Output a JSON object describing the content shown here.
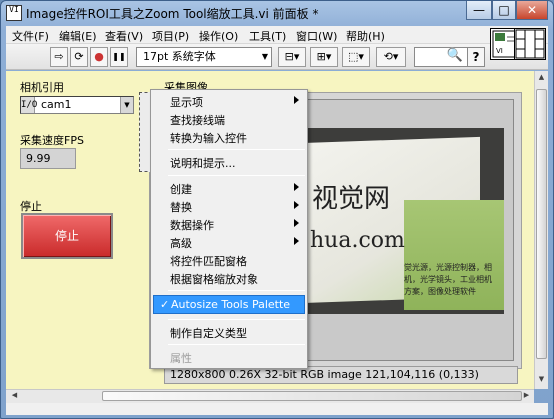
{
  "window": {
    "title": "Image控件ROI工具之Zoom Tool缩放工具.vi 前面板 *",
    "icon_text": "VI",
    "minimize_glyph": "—",
    "maximize_glyph": "□",
    "close_glyph": "✕"
  },
  "menubar": {
    "items": [
      {
        "label": "文件(F)"
      },
      {
        "label": "编辑(E)"
      },
      {
        "label": "查看(V)"
      },
      {
        "label": "项目(P)"
      },
      {
        "label": "操作(O)"
      },
      {
        "label": "工具(T)"
      },
      {
        "label": "窗口(W)"
      },
      {
        "label": "帮助(H)"
      }
    ]
  },
  "toolbar": {
    "run_arrow_glyph": "⇨",
    "run_continuous_glyph": "⟳",
    "abort_glyph": "●",
    "pause_glyph": "❚❚",
    "font_select": "17pt 系统字体",
    "font_caret": "▼",
    "align_glyph": "⊟▾",
    "distribute_glyph": "⊞▾",
    "resize_glyph": "⬚▾",
    "reorder_glyph": "⟲▾",
    "search_glyph": "🔍",
    "help_glyph": "?"
  },
  "panel": {
    "camera_label": "相机引用",
    "camera_value": "cam1",
    "camera_icon": "I/O",
    "dropdown_glyph": "▼",
    "fps_label": "采集速度FPS",
    "fps_value": "9.99",
    "stop_label": "停止",
    "stop_button": "停止",
    "image_label": "采集图像",
    "image_status": "1280x800 0.26X 32-bit RGB image 121,104,116     (0,133)",
    "photo_text_1": "视觉网",
    "photo_text_2": "hua.com",
    "photo_text_3": "觉光源，光源控制器，相",
    "photo_text_4": "机，光学镜头，工业相机",
    "photo_text_5": "方案，图像处理软件"
  },
  "context_menu": {
    "items": [
      {
        "label": "显示项",
        "submenu": true
      },
      {
        "label": "查找接线端"
      },
      {
        "label": "转换为输入控件"
      },
      {
        "separator": true
      },
      {
        "label": "说明和提示..."
      },
      {
        "separator": true
      },
      {
        "label": "创建",
        "submenu": true
      },
      {
        "label": "替换",
        "submenu": true
      },
      {
        "label": "数据操作",
        "submenu": true
      },
      {
        "label": "高级",
        "submenu": true
      },
      {
        "label": "将控件匹配窗格"
      },
      {
        "label": "根据窗格缩放对象"
      },
      {
        "separator": true
      },
      {
        "label": "Autosize Tools Palette",
        "checked": true,
        "highlighted": true
      },
      {
        "separator": true
      },
      {
        "label": "制作自定义类型"
      },
      {
        "separator": true
      },
      {
        "label": "属性",
        "disabled": true
      }
    ],
    "check_glyph": "✓"
  },
  "colors": {
    "panel_bg": "#f7f5c1",
    "highlight": "#3399ff",
    "stop_red": "#d83a3a",
    "title_blue": "#a9c4e4"
  }
}
